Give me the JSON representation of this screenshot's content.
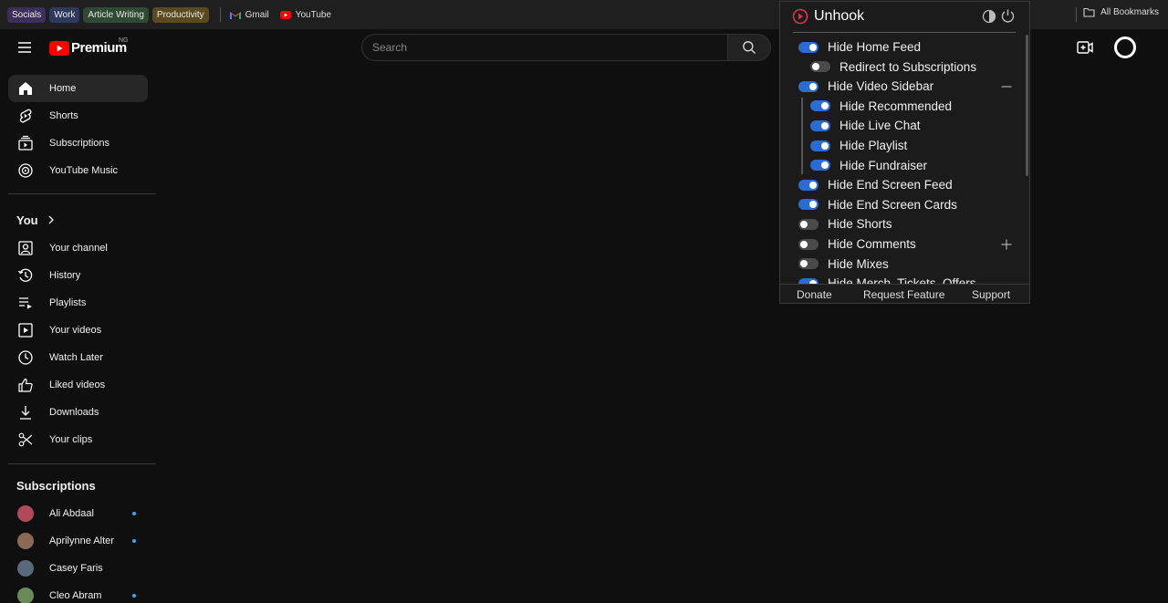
{
  "bookmarks": {
    "groups": [
      {
        "label": "Socials",
        "color": "#3d2f5c"
      },
      {
        "label": "Work",
        "color": "#2e3a5c"
      },
      {
        "label": "Article Writing",
        "color": "#2f4a33"
      },
      {
        "label": "Productivity",
        "color": "#5a4a1f"
      }
    ],
    "links": [
      {
        "label": "Gmail",
        "icon": "gmail-icon"
      },
      {
        "label": "YouTube",
        "icon": "youtube-icon"
      }
    ],
    "all_bookmarks": "All Bookmarks"
  },
  "masthead": {
    "logo_text": "Premium",
    "region": "NG",
    "search_placeholder": "Search"
  },
  "sidebar": {
    "main": [
      {
        "label": "Home",
        "icon": "home-icon",
        "active": true
      },
      {
        "label": "Shorts",
        "icon": "shorts-icon"
      },
      {
        "label": "Subscriptions",
        "icon": "subscriptions-icon"
      },
      {
        "label": "YouTube Music",
        "icon": "music-icon"
      }
    ],
    "you_heading": "You",
    "you": [
      {
        "label": "Your channel",
        "icon": "channel-icon"
      },
      {
        "label": "History",
        "icon": "history-icon"
      },
      {
        "label": "Playlists",
        "icon": "playlists-icon"
      },
      {
        "label": "Your videos",
        "icon": "videos-icon"
      },
      {
        "label": "Watch Later",
        "icon": "clock-icon"
      },
      {
        "label": "Liked videos",
        "icon": "thumbs-up-icon"
      },
      {
        "label": "Downloads",
        "icon": "download-icon"
      },
      {
        "label": "Your clips",
        "icon": "scissors-icon"
      }
    ],
    "subscriptions_heading": "Subscriptions",
    "subscriptions": [
      {
        "label": "Ali Abdaal",
        "color": "#b04a5a",
        "new": true
      },
      {
        "label": "Aprilynne Alter",
        "color": "#8a6a55",
        "new": true
      },
      {
        "label": "Casey Faris",
        "color": "#5a6a7a",
        "new": false
      },
      {
        "label": "Cleo Abram",
        "color": "#6a8a5a",
        "new": true
      }
    ]
  },
  "unhook": {
    "title": "Unhook",
    "options": [
      {
        "label": "Hide Home Feed",
        "on": true,
        "level": 0
      },
      {
        "label": "Redirect to Subscriptions",
        "on": false,
        "level": 1
      },
      {
        "label": "Hide Video Sidebar",
        "on": true,
        "level": 0,
        "expander": "minus"
      },
      {
        "label": "Hide Recommended",
        "on": true,
        "level": 1
      },
      {
        "label": "Hide Live Chat",
        "on": true,
        "level": 1
      },
      {
        "label": "Hide Playlist",
        "on": true,
        "level": 1
      },
      {
        "label": "Hide Fundraiser",
        "on": true,
        "level": 1
      },
      {
        "label": "Hide End Screen Feed",
        "on": true,
        "level": 0
      },
      {
        "label": "Hide End Screen Cards",
        "on": true,
        "level": 0
      },
      {
        "label": "Hide Shorts",
        "on": false,
        "level": 0
      },
      {
        "label": "Hide Comments",
        "on": false,
        "level": 0,
        "expander": "plus"
      },
      {
        "label": "Hide Mixes",
        "on": false,
        "level": 0
      },
      {
        "label": "Hide Merch, Tickets, Offers",
        "on": true,
        "level": 0
      }
    ],
    "footer": {
      "donate": "Donate",
      "request": "Request Feature",
      "support": "Support"
    }
  }
}
